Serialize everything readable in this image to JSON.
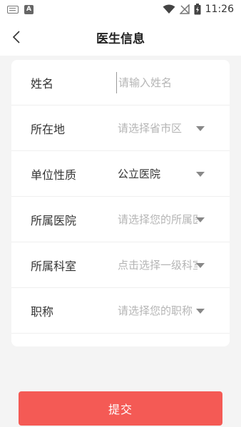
{
  "status_bar": {
    "time": "11:26",
    "icons": [
      "keyboard-icon",
      "a-notification-icon",
      "wifi-icon",
      "signal-off-icon",
      "battery-charging-icon"
    ]
  },
  "header": {
    "title": "医生信息",
    "back_icon": "chevron-left-icon"
  },
  "form": {
    "name": {
      "label": "姓名",
      "placeholder": "请输入姓名",
      "value": ""
    },
    "location": {
      "label": "所在地",
      "placeholder": "请选择省市区"
    },
    "unit_type": {
      "label": "单位性质",
      "value": "公立医院"
    },
    "hospital": {
      "label": "所属医院",
      "placeholder": "请选择您的所属医院"
    },
    "department": {
      "label": "所属科室",
      "placeholder": "点击选择一级科室"
    },
    "title": {
      "label": "职称",
      "placeholder": "请选择您的职称"
    }
  },
  "submit_label": "提交",
  "colors": {
    "accent": "#f45a55",
    "placeholder": "#b5b5b5",
    "background": "#f4f4f4"
  }
}
